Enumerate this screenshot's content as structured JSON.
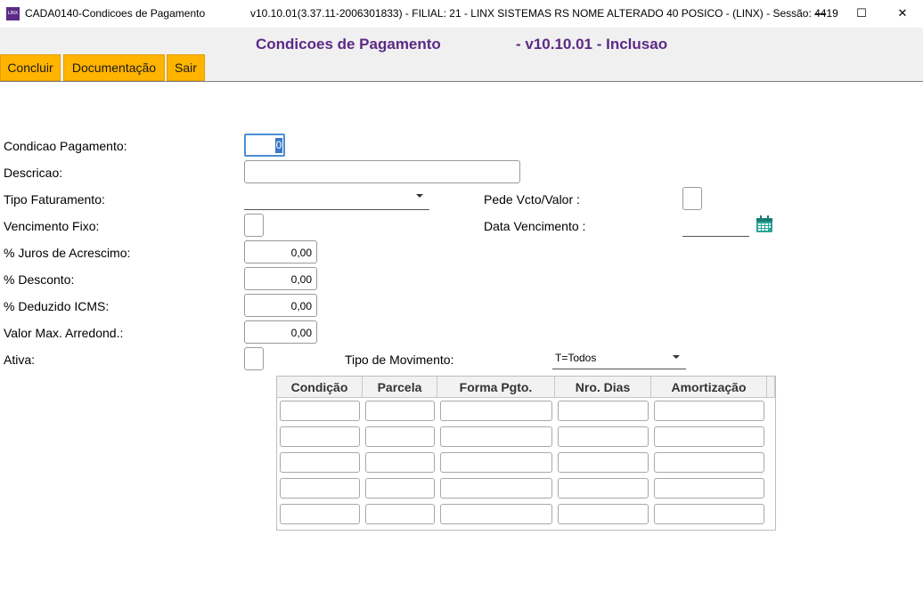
{
  "window": {
    "title": "CADA0140-Condicoes de Pagamento",
    "info": "v10.10.01(3.37.11-2006301833)   - FILIAL: 21 - LINX SISTEMAS RS NOME ALTERADO 40 POSICO - (LINX) - Sessão: 4419",
    "icon_text": "LINX",
    "controls": {
      "minimize": "—",
      "maximize": "☐",
      "close": "✕"
    }
  },
  "header": {
    "form_title": "Condicoes de Pagamento",
    "mode": "- v10.10.01 - Inclusao"
  },
  "toolbar": {
    "concluir": "Concluir",
    "documentacao": "Documentação",
    "sair": "Sair"
  },
  "form": {
    "condicao_pagamento": {
      "label": "Condicao Pagamento:",
      "value": "0"
    },
    "descricao": {
      "label": "Descricao:",
      "value": ""
    },
    "tipo_faturamento": {
      "label": "Tipo Faturamento:",
      "value": ""
    },
    "pede_vcto_valor": {
      "label": "Pede Vcto/Valor :",
      "checked": false
    },
    "vencimento_fixo": {
      "label": "Vencimento Fixo:",
      "checked": false
    },
    "data_vencimento": {
      "label": "Data Vencimento :",
      "value": ""
    },
    "juros": {
      "label": "% Juros de Acrescimo:",
      "value": "0,00"
    },
    "desconto": {
      "label": "% Desconto:",
      "value": "0,00"
    },
    "deduzido_icms": {
      "label": "% Deduzido ICMS:",
      "value": "0,00"
    },
    "valor_max": {
      "label": "Valor Max. Arredond.:",
      "value": "0,00"
    },
    "ativa": {
      "label": "Ativa:",
      "checked": false
    },
    "tipo_movimento": {
      "label": "Tipo de Movimento:",
      "value": "T=Todos"
    }
  },
  "grid": {
    "columns": [
      "Condição",
      "Parcela",
      "Forma Pgto.",
      "Nro. Dias",
      "Amortização"
    ],
    "rows": [
      [
        "",
        "",
        "",
        "",
        ""
      ],
      [
        "",
        "",
        "",
        "",
        ""
      ],
      [
        "",
        "",
        "",
        "",
        ""
      ],
      [
        "",
        "",
        "",
        "",
        ""
      ],
      [
        "",
        "",
        "",
        "",
        ""
      ]
    ]
  },
  "colors": {
    "accent": "#5b2a86",
    "toolbar_button": "#ffb400",
    "focus": "#4a8fd4"
  }
}
